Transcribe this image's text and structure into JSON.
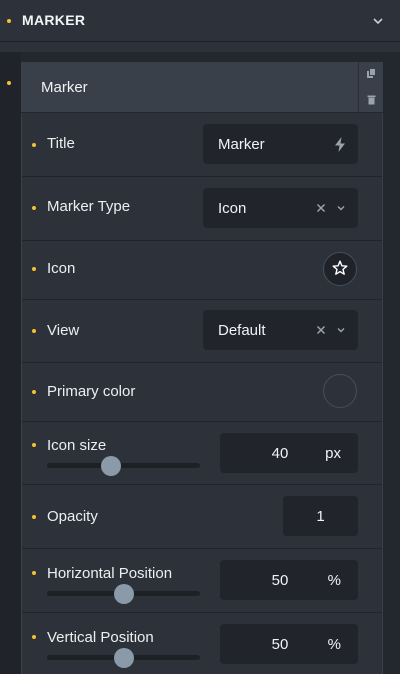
{
  "section": {
    "title": "MARKER",
    "collapse_icon": "chevron-down-icon"
  },
  "repeater_item": {
    "label": "Marker",
    "tools": [
      "copy-icon",
      "trash-icon"
    ]
  },
  "fields": {
    "title": {
      "label": "Title",
      "value": "Marker",
      "dynamic_icon": "bolt-icon"
    },
    "marker_type": {
      "label": "Marker Type",
      "value": "Icon"
    },
    "icon": {
      "label": "Icon",
      "icon": "star-icon"
    },
    "view": {
      "label": "View",
      "value": "Default"
    },
    "primary_color": {
      "label": "Primary color",
      "value_hex": "#2d323a"
    },
    "icon_size": {
      "label": "Icon size",
      "value": "40",
      "unit": "px",
      "slider_fraction": 0.42
    },
    "opacity": {
      "label": "Opacity",
      "value": "1"
    },
    "horizontal_position": {
      "label": "Horizontal Position",
      "value": "50",
      "unit": "%",
      "slider_fraction": 0.5
    },
    "vertical_position": {
      "label": "Vertical Position",
      "value": "50",
      "unit": "%",
      "slider_fraction": 0.5
    }
  },
  "colors": {
    "accent_dot": "#f2c230",
    "panel_bg": "#2d323a",
    "input_bg": "#21252b"
  }
}
